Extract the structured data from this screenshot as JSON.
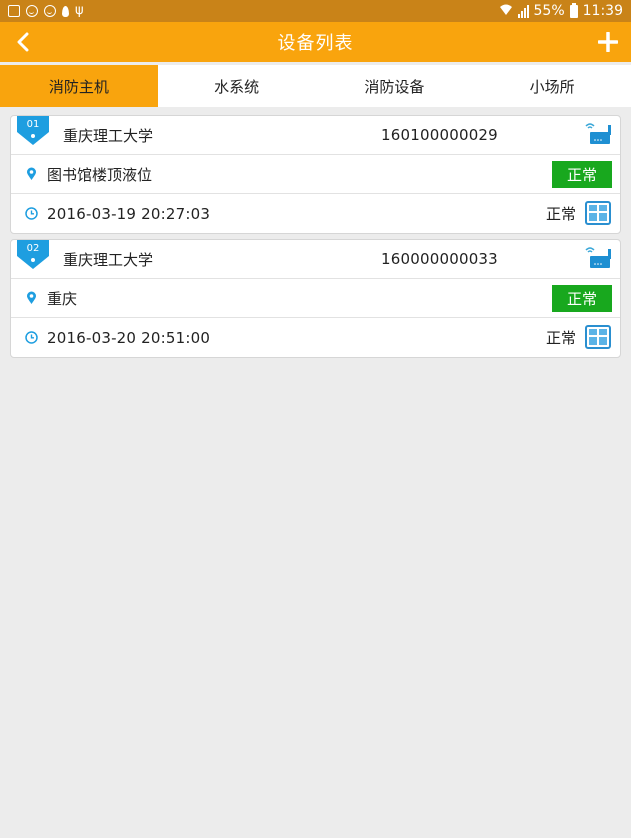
{
  "status_bar": {
    "battery": "55%",
    "time": "11:39",
    "icons": [
      "gallery-icon",
      "face-icon",
      "face-icon",
      "fire-icon",
      "usb-icon",
      "wifi-icon",
      "signal-icon",
      "battery-icon"
    ]
  },
  "header": {
    "title": "设备列表",
    "back_icon": "chevron-left-icon",
    "add_icon": "plus-icon"
  },
  "tabs": [
    {
      "label": "消防主机",
      "active": true
    },
    {
      "label": "水系统",
      "active": false
    },
    {
      "label": "消防设备",
      "active": false
    },
    {
      "label": "小场所",
      "active": false
    }
  ],
  "devices": [
    {
      "number": "01",
      "unit": "重庆理工大学",
      "code": "160100000029",
      "location": "图书馆楼顶液位",
      "status_button": "正常",
      "time": "2016-03-19 20:27:03",
      "state": "正常"
    },
    {
      "number": "02",
      "unit": "重庆理工大学",
      "code": "160000000033",
      "location": "重庆",
      "status_button": "正常",
      "time": "2016-03-20 20:51:00",
      "state": "正常"
    }
  ],
  "colors": {
    "header": "#f9a40d",
    "status_bar": "#c98318",
    "active_tab": "#f9a40d",
    "status_ok": "#18a81e",
    "badge": "#1e9ee0",
    "background": "#ececec"
  }
}
